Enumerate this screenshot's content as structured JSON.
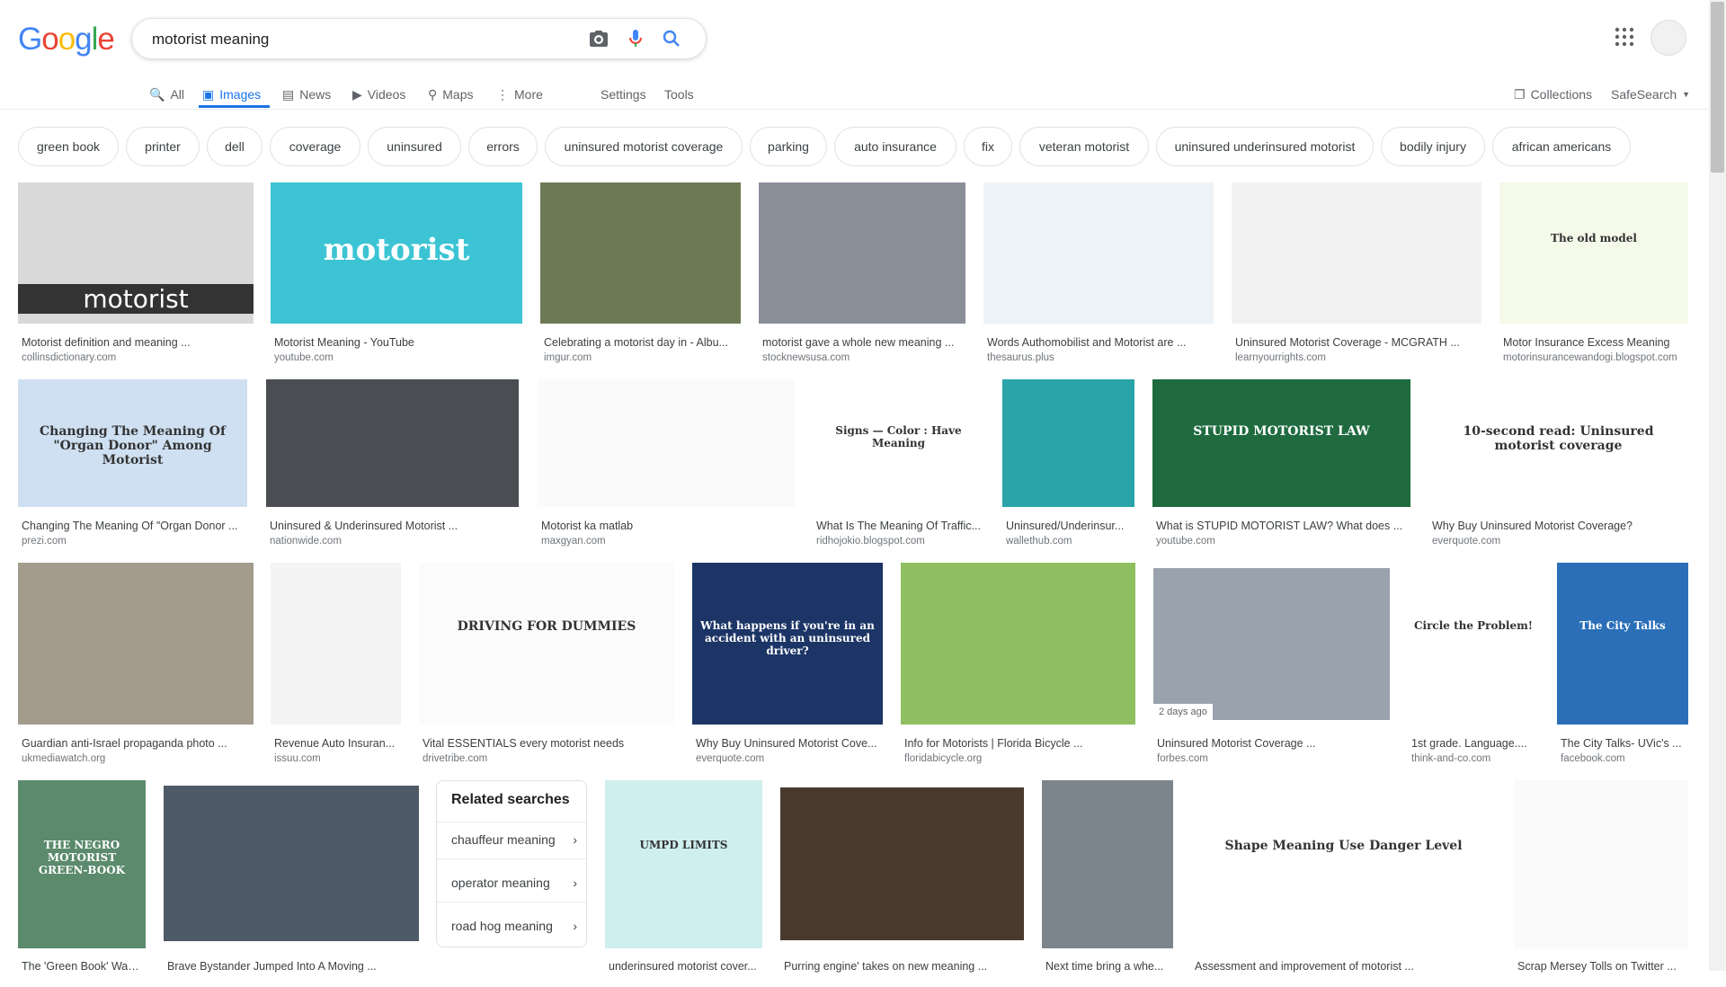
{
  "logo": {
    "letters": [
      "G",
      "o",
      "o",
      "g",
      "l",
      "e"
    ],
    "colors": [
      "#4285f4",
      "#ea4335",
      "#fbbc05",
      "#4285f4",
      "#34a853",
      "#ea4335"
    ]
  },
  "search": {
    "query": "motorist meaning"
  },
  "tabs": [
    {
      "label": "All",
      "icon": "search-icon"
    },
    {
      "label": "Images",
      "icon": "image-icon"
    },
    {
      "label": "News",
      "icon": "news-icon"
    },
    {
      "label": "Videos",
      "icon": "video-icon"
    },
    {
      "label": "Maps",
      "icon": "map-pin-icon"
    },
    {
      "label": "More",
      "icon": "more-vert-icon"
    },
    {
      "label": "Settings"
    },
    {
      "label": "Tools"
    }
  ],
  "right_nav": {
    "collections": "Collections",
    "safesearch": "SafeSearch"
  },
  "chips": [
    "green book",
    "printer",
    "dell",
    "coverage",
    "uninsured",
    "errors",
    "uninsured motorist coverage",
    "parking",
    "auto insurance",
    "fix",
    "veteran motorist",
    "uninsured underinsured motorist",
    "bodily injury",
    "african americans"
  ],
  "results": [
    {
      "caption": "Motorist definition and meaning ...",
      "source": "collinsdictionary.com",
      "thumb_text": "motorist",
      "color": "#d9d9d9"
    },
    {
      "caption": "Motorist Meaning - YouTube",
      "source": "youtube.com",
      "thumb_text": "motorist",
      "color": "#3cc4d4"
    },
    {
      "caption": "Celebrating a motorist day in - Albu...",
      "source": "imgur.com",
      "thumb_text": "",
      "color": "#6d7a55"
    },
    {
      "caption": "motorist gave a whole new meaning ...",
      "source": "stocknewsusa.com",
      "thumb_text": "",
      "color": "#8a8f9a"
    },
    {
      "caption": "Words Authomobilist and Motorist are ...",
      "source": "thesaurus.plus",
      "thumb_text": "",
      "color": "#eef3f7"
    },
    {
      "caption": "Uninsured Motorist Coverage - MCGRATH ...",
      "source": "learnyourrights.com",
      "thumb_text": "",
      "color": "#f2f2f2"
    },
    {
      "caption": "Motor Insurance Excess Meaning",
      "source": "motorinsurancewandogi.blogspot.com",
      "thumb_text": "The old model",
      "color": "#f4f9ea"
    },
    {
      "caption": "Changing The Meaning Of \"Organ Donor ...",
      "source": "prezi.com",
      "thumb_text": "Changing The Meaning Of \"Organ Donor\" Among Motorist",
      "color": "#cfe0f2"
    },
    {
      "caption": "Uninsured & Underinsured Motorist ...",
      "source": "nationwide.com",
      "thumb_text": "",
      "color": "#4a4d52"
    },
    {
      "caption": "Motorist ka matlab",
      "source": "maxgyan.com",
      "thumb_text": "",
      "color": "#fafafa"
    },
    {
      "caption": "What Is The Meaning Of Traffic...",
      "source": "ridhojokio.blogspot.com",
      "thumb_text": "Signs — Color : Have Meaning",
      "color": "#ffffff"
    },
    {
      "caption": "Uninsured/Underinsur...",
      "source": "wallethub.com",
      "thumb_text": "",
      "color": "#2aa4a8"
    },
    {
      "caption": "What is STUPID MOTORIST LAW? What does ...",
      "source": "youtube.com",
      "thumb_text": "STUPID MOTORIST LAW",
      "color": "#1f6b3f"
    },
    {
      "caption": "Why Buy Uninsured Motorist Coverage?",
      "source": "everquote.com",
      "thumb_text": "10-second read: Uninsured motorist coverage",
      "color": "#ffffff"
    },
    {
      "caption": "Guardian anti-Israel propaganda photo ...",
      "source": "ukmediawatch.org",
      "thumb_text": "",
      "color": "#a39c8c"
    },
    {
      "caption": "Revenue Auto Insuran...",
      "source": "issuu.com",
      "thumb_text": "",
      "color": "#f4f4f4"
    },
    {
      "caption": "Vital ESSENTIALS every motorist needs",
      "source": "drivetribe.com",
      "thumb_text": "DRIVING FOR DUMMIES",
      "color": "#fbfbfb"
    },
    {
      "caption": "Why Buy Uninsured Motorist Cove...",
      "source": "everquote.com",
      "thumb_text": "What happens if you're in an accident with an uninsured driver?",
      "color": "#1c3566"
    },
    {
      "caption": "Info for Motorists | Florida Bicycle ...",
      "source": "floridabicycle.org",
      "thumb_text": "",
      "color": "#8fbf60"
    },
    {
      "caption": "Uninsured Motorist Coverage ...",
      "source": "forbes.com",
      "thumb_text": "",
      "color": "#9aa3ad",
      "badge": "2 days ago"
    },
    {
      "caption": "1st grade. Language....",
      "source": "think-and-co.com",
      "thumb_text": "Circle the Problem!",
      "color": "#ffffff"
    },
    {
      "caption": "The City Talks- UVic's ...",
      "source": "facebook.com",
      "thumb_text": "The City Talks",
      "color": "#2a6fb8"
    },
    {
      "caption": "The 'Green Book' Was...",
      "source": "",
      "thumb_text": "THE NEGRO MOTORIST GREEN-BOOK",
      "color": "#5b8a6c"
    },
    {
      "caption": "Brave Bystander Jumped Into A Moving ...",
      "source": "",
      "thumb_text": "",
      "color": "#4e5a66"
    },
    {
      "caption": "underinsured motorist cover...",
      "source": "",
      "thumb_text": "UMPD LIMITS",
      "color": "#cfeeee"
    },
    {
      "caption": "Purring engine' takes on new meaning ...",
      "source": "",
      "thumb_text": "",
      "color": "#4a3a2e"
    },
    {
      "caption": "Next time bring a whe...",
      "source": "",
      "thumb_text": "",
      "color": "#7d858c"
    },
    {
      "caption": "Assessment and improvement of motorist ...",
      "source": "",
      "thumb_text": "Shape  Meaning  Use  Danger Level",
      "color": "#ffffff"
    },
    {
      "caption": "Scrap Mersey Tolls on Twitter ...",
      "source": "",
      "thumb_text": "",
      "color": "#fafafa"
    }
  ],
  "related": {
    "heading": "Related searches",
    "items": [
      "chauffeur meaning",
      "operator meaning",
      "road hog meaning"
    ]
  }
}
